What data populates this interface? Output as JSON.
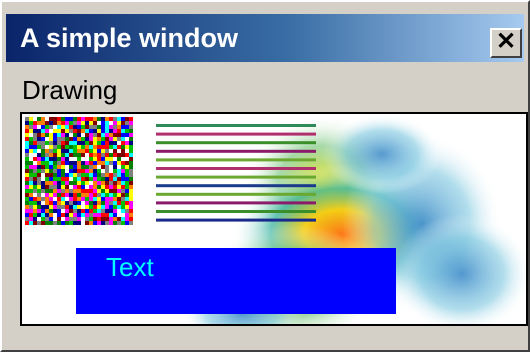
{
  "window": {
    "title": "A simple window"
  },
  "titlebar": {
    "close_label": "✕",
    "close_icon": "close-icon"
  },
  "group": {
    "label": "Drawing"
  },
  "canvas": {
    "text_box_label": "Text",
    "text_color": "#00ffff",
    "box_color": "#0000ff",
    "line_colors": [
      "#2e8b57",
      "#b0306e",
      "#3a8f2a",
      "#8b1a6b",
      "#6aa830",
      "#b0306e",
      "#6aa830",
      "#1a3a8b",
      "#6aa830",
      "#8b1a6b",
      "#3a8f2a",
      "#1a2a8b"
    ]
  }
}
